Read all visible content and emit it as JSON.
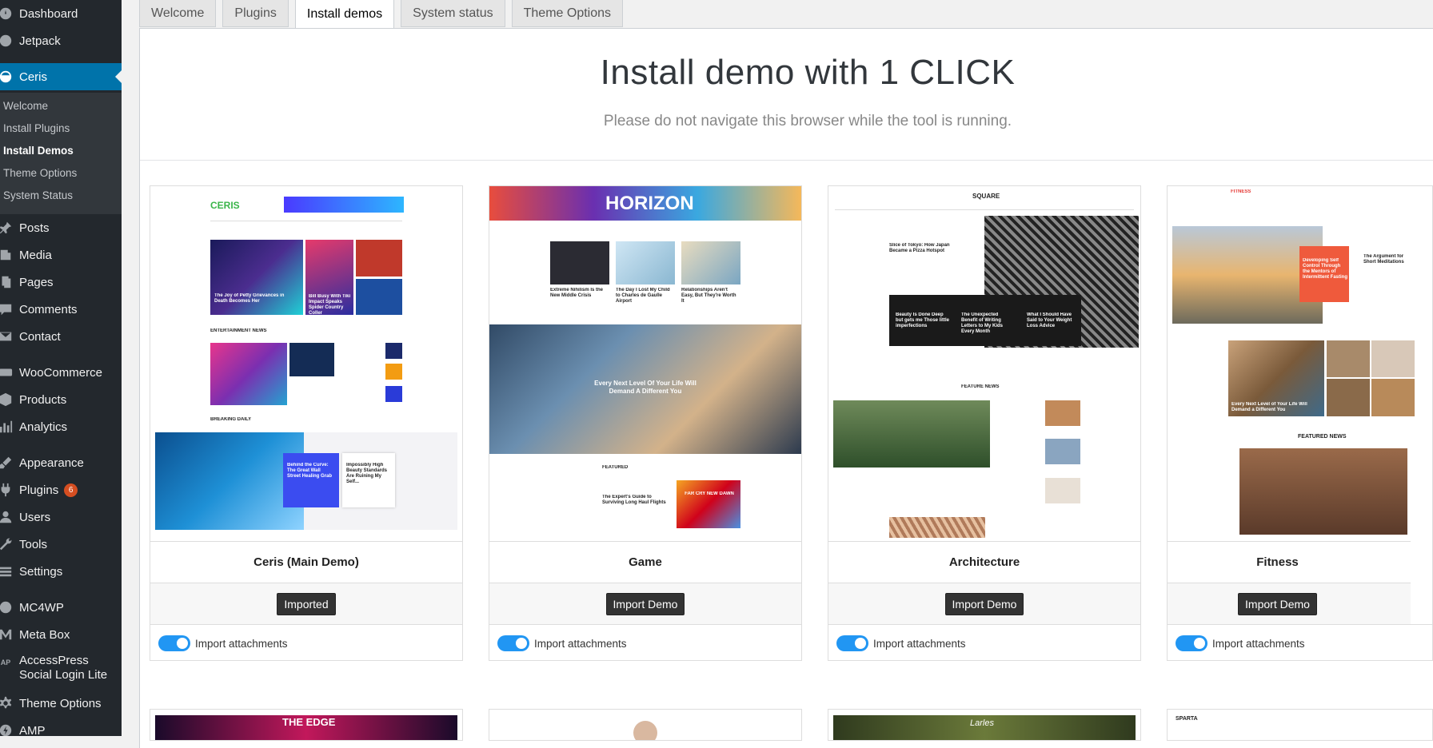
{
  "sidebar": {
    "items": [
      {
        "label": "Dashboard",
        "icon": "dashboard-icon"
      },
      {
        "label": "Jetpack",
        "icon": "jetpack-icon"
      },
      {
        "label": "Ceris",
        "icon": "ceris-icon"
      },
      {
        "label": "Posts",
        "icon": "pin-icon"
      },
      {
        "label": "Media",
        "icon": "media-icon"
      },
      {
        "label": "Pages",
        "icon": "pages-icon"
      },
      {
        "label": "Comments",
        "icon": "comment-icon"
      },
      {
        "label": "Contact",
        "icon": "mail-icon"
      },
      {
        "label": "WooCommerce",
        "icon": "woocommerce-icon"
      },
      {
        "label": "Products",
        "icon": "box-icon"
      },
      {
        "label": "Analytics",
        "icon": "bar-chart-icon"
      },
      {
        "label": "Appearance",
        "icon": "brush-icon"
      },
      {
        "label": "Plugins",
        "icon": "plug-icon",
        "badge": "6"
      },
      {
        "label": "Users",
        "icon": "user-icon"
      },
      {
        "label": "Tools",
        "icon": "wrench-icon"
      },
      {
        "label": "Settings",
        "icon": "settings-icon"
      },
      {
        "label": "MC4WP",
        "icon": "mc4wp-icon"
      },
      {
        "label": "Meta Box",
        "icon": "meta-box-icon"
      },
      {
        "label": "AccessPress Social Login Lite",
        "icon": "ap-icon"
      },
      {
        "label": "Theme Options",
        "icon": "gear-icon"
      },
      {
        "label": "AMP",
        "icon": "amp-icon"
      }
    ],
    "submenu": [
      "Welcome",
      "Install Plugins",
      "Install Demos",
      "Theme Options",
      "System Status"
    ]
  },
  "tabs": [
    "Welcome",
    "Plugins",
    "Install demos",
    "System status",
    "Theme Options"
  ],
  "header": {
    "title": "Install demo with 1 CLICK",
    "subtitle": "Please do not navigate this browser while the tool is running."
  },
  "demos": [
    {
      "name": "Ceris (Main Demo)",
      "button": "Imported",
      "attach": "Import attachments"
    },
    {
      "name": "Game",
      "button": "Import Demo",
      "attach": "Import attachments"
    },
    {
      "name": "Architecture",
      "button": "Import Demo",
      "attach": "Import attachments"
    },
    {
      "name": "Fitness",
      "button": "Import Demo",
      "attach": "Import attachments"
    }
  ],
  "previews": {
    "ceris": {
      "logo": "CERIS",
      "hero1": "The Joy of Petty Grievances in Death Becomes Her",
      "hero2": "Bill Busy With Tiki Impact Speaks Spider Country Coller",
      "section1": "ENTERTAINMENT NEWS",
      "section2": "BREAKING DAILY",
      "swim": "Behind the Curve: The Great Wall Street Healing Grab",
      "swim2": "Impossibly High Beauty Standards Are Ruining My Self..."
    },
    "game": {
      "logo": "HORIZON",
      "hero": "Every Next Level Of Your Life Will Demand A Different You",
      "c1": "Extreme Nihilism Is the New Middle Crisis",
      "c2": "The Day I Lost My Child to Charles de Gaulle Airport",
      "c3": "Relationships Aren't Easy, But They're Worth It",
      "featured": "FEATURED",
      "guide": "The Expert's Guide to Surviving Long Haul Flights",
      "farcry": "FAR CRY NEW DAWN"
    },
    "arch": {
      "logo": "SQUARE",
      "hero": "Slice of Tokyo: How Japan Became a Pizza Hotspot",
      "b1": "Beauty Is Done Deep but gets me Those little imperfections",
      "b2": "The Unexpected Benefit of Writing Letters to My Kids Every Month",
      "b3": "What I Should Have Said to Your Weight Loss Advice",
      "section": "FEATURE NEWS"
    },
    "fit": {
      "logo": "FITNESS",
      "r1": "Developing Self Control Through the Mentors of Intermittent Fasting",
      "r2": "The Argument for Short Meditations",
      "caption": "Every Next Level of Your Life Will Demand a Different You",
      "section": "FEATURED NEWS"
    },
    "row2": {
      "edge": "THE EDGE",
      "sparta": "SPARTA",
      "larles": "Larles"
    }
  },
  "colors": {
    "sidebar": "#23282d",
    "accent": "#0073aa",
    "toggle": "#2196f3",
    "badge": "#d54e21"
  }
}
